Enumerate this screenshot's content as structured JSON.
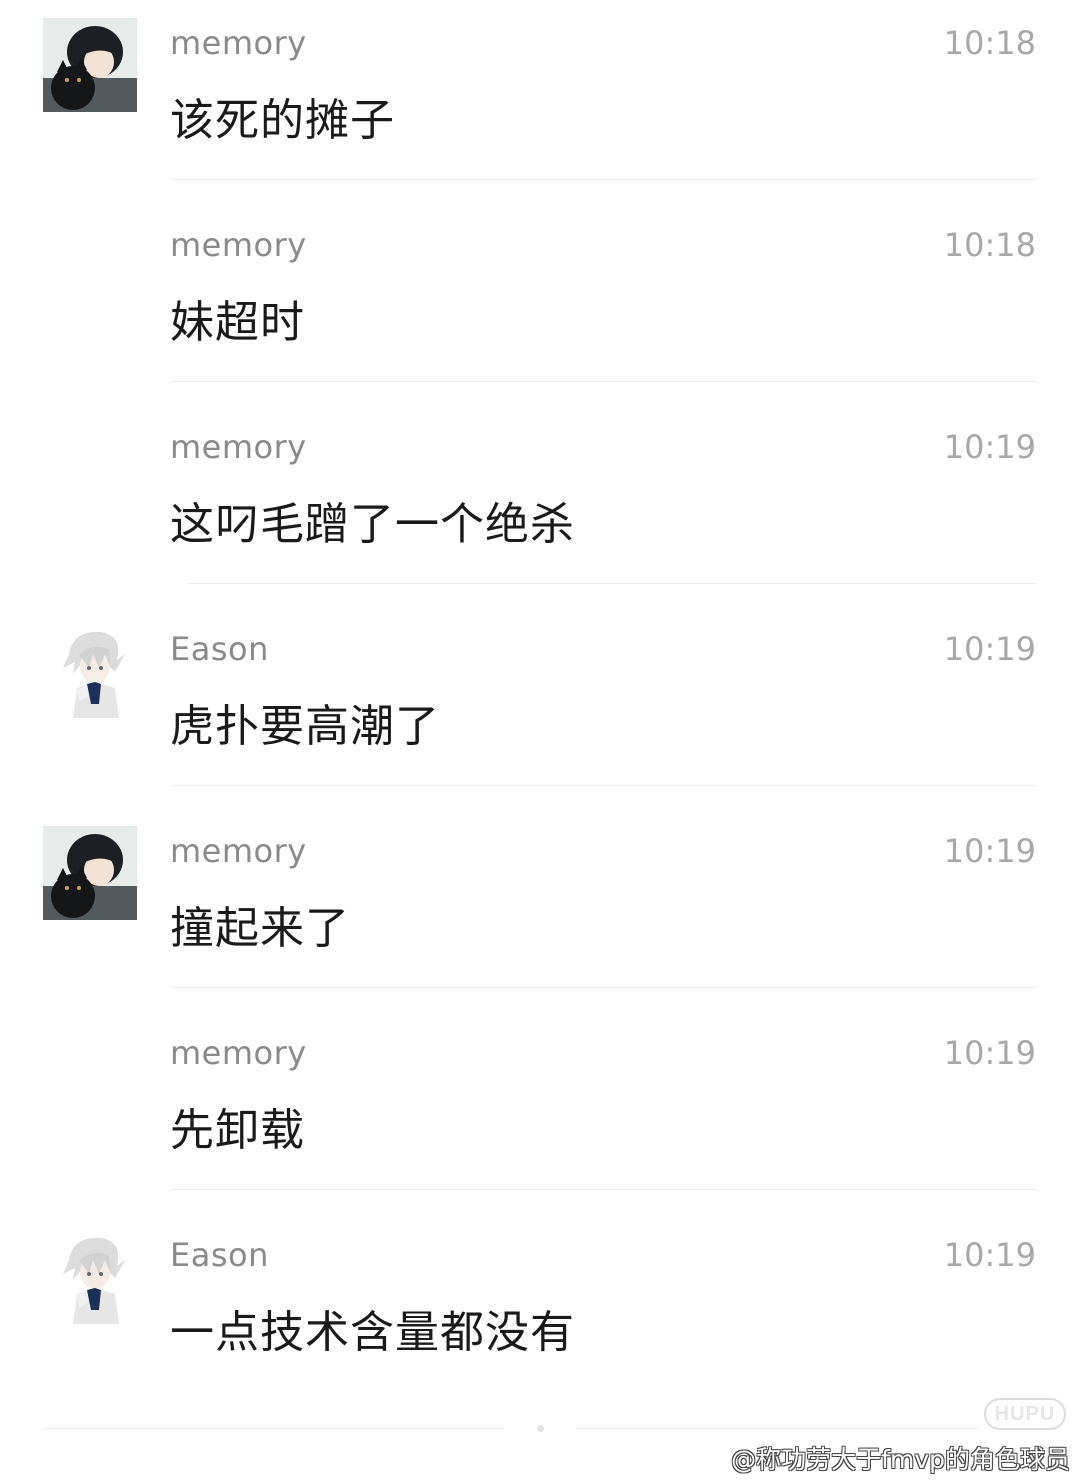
{
  "messages": [
    {
      "sender": "memory",
      "time": "10:18",
      "text": "该死的摊子",
      "avatar": "memory-avatar"
    },
    {
      "sender": "memory",
      "time": "10:18",
      "text": "妹超时",
      "avatar": null
    },
    {
      "sender": "memory",
      "time": "10:19",
      "text": "这叼毛蹭了一个绝杀",
      "avatar": null
    },
    {
      "sender": "Eason",
      "time": "10:19",
      "text": "虎扑要高潮了",
      "avatar": "eason-avatar"
    },
    {
      "sender": "memory",
      "time": "10:19",
      "text": "撞起来了",
      "avatar": "memory-avatar"
    },
    {
      "sender": "memory",
      "time": "10:19",
      "text": "先卸载",
      "avatar": null
    },
    {
      "sender": "Eason",
      "time": "10:19",
      "text": "一点技术含量都没有",
      "avatar": "eason-avatar"
    }
  ],
  "logo": "HUPU",
  "watermark": "@称功劳大于fmvp的角色球员",
  "colors": {
    "sender": "#8a8a8a",
    "time": "#a8a8a8",
    "text": "#1a1a1a",
    "divider": "#ececec"
  }
}
